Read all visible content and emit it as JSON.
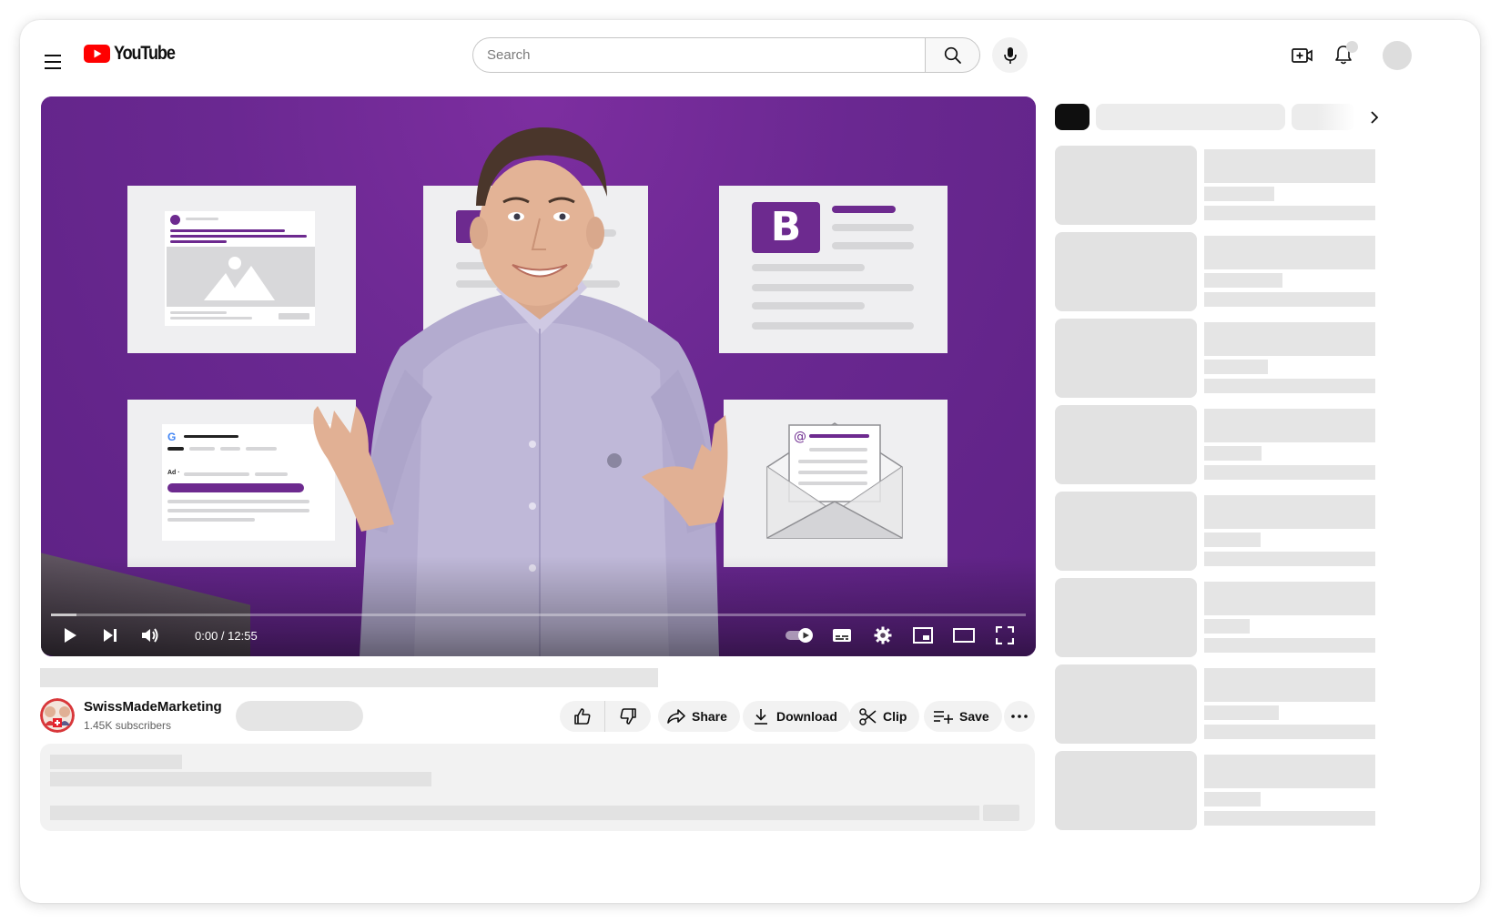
{
  "header": {
    "logo_text": "YouTube",
    "search_placeholder": "Search"
  },
  "player": {
    "time_display": "0:00 / 12:55",
    "progress": 0.0
  },
  "channel": {
    "name": "SwissMadeMarketing",
    "subscribers": "1.45K subscribers"
  },
  "actions": {
    "share_label": "Share",
    "download_label": "Download",
    "clip_label": "Clip",
    "save_label": "Save"
  },
  "colors": {
    "brand_red": "#ff0000",
    "video_purple": "#6a2891",
    "skeleton": "#e5e5e5"
  },
  "icons": [
    "menu-icon",
    "search-icon",
    "mic-icon",
    "create-icon",
    "bell-icon",
    "play-icon",
    "next-icon",
    "volume-icon",
    "subtitles-icon",
    "settings-icon",
    "miniplayer-icon",
    "theater-icon",
    "fullscreen-icon",
    "like-icon",
    "dislike-icon",
    "share-icon",
    "download-icon",
    "clip-icon",
    "save-icon",
    "more-icon",
    "chevron-right-icon"
  ]
}
